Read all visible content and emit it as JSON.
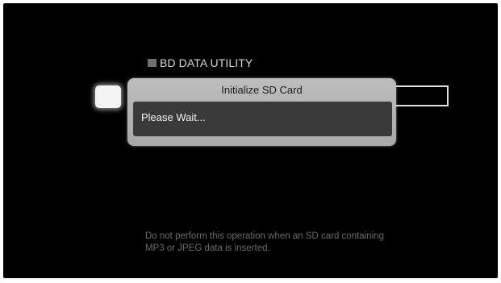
{
  "screen": {
    "header": {
      "title": "BD DATA UTILITY"
    },
    "dialog": {
      "title": "Initialize SD Card",
      "message": "Please Wait..."
    },
    "notice": {
      "line1": "Do not perform this operation when an SD card containing",
      "line2": "MP3 or JPEG data is inserted."
    }
  },
  "colors": {
    "background": "#000000",
    "dialog_frame": "#b4b4b4",
    "dialog_body": "#3a3a3a",
    "notice_text": "#6a6a6a"
  }
}
